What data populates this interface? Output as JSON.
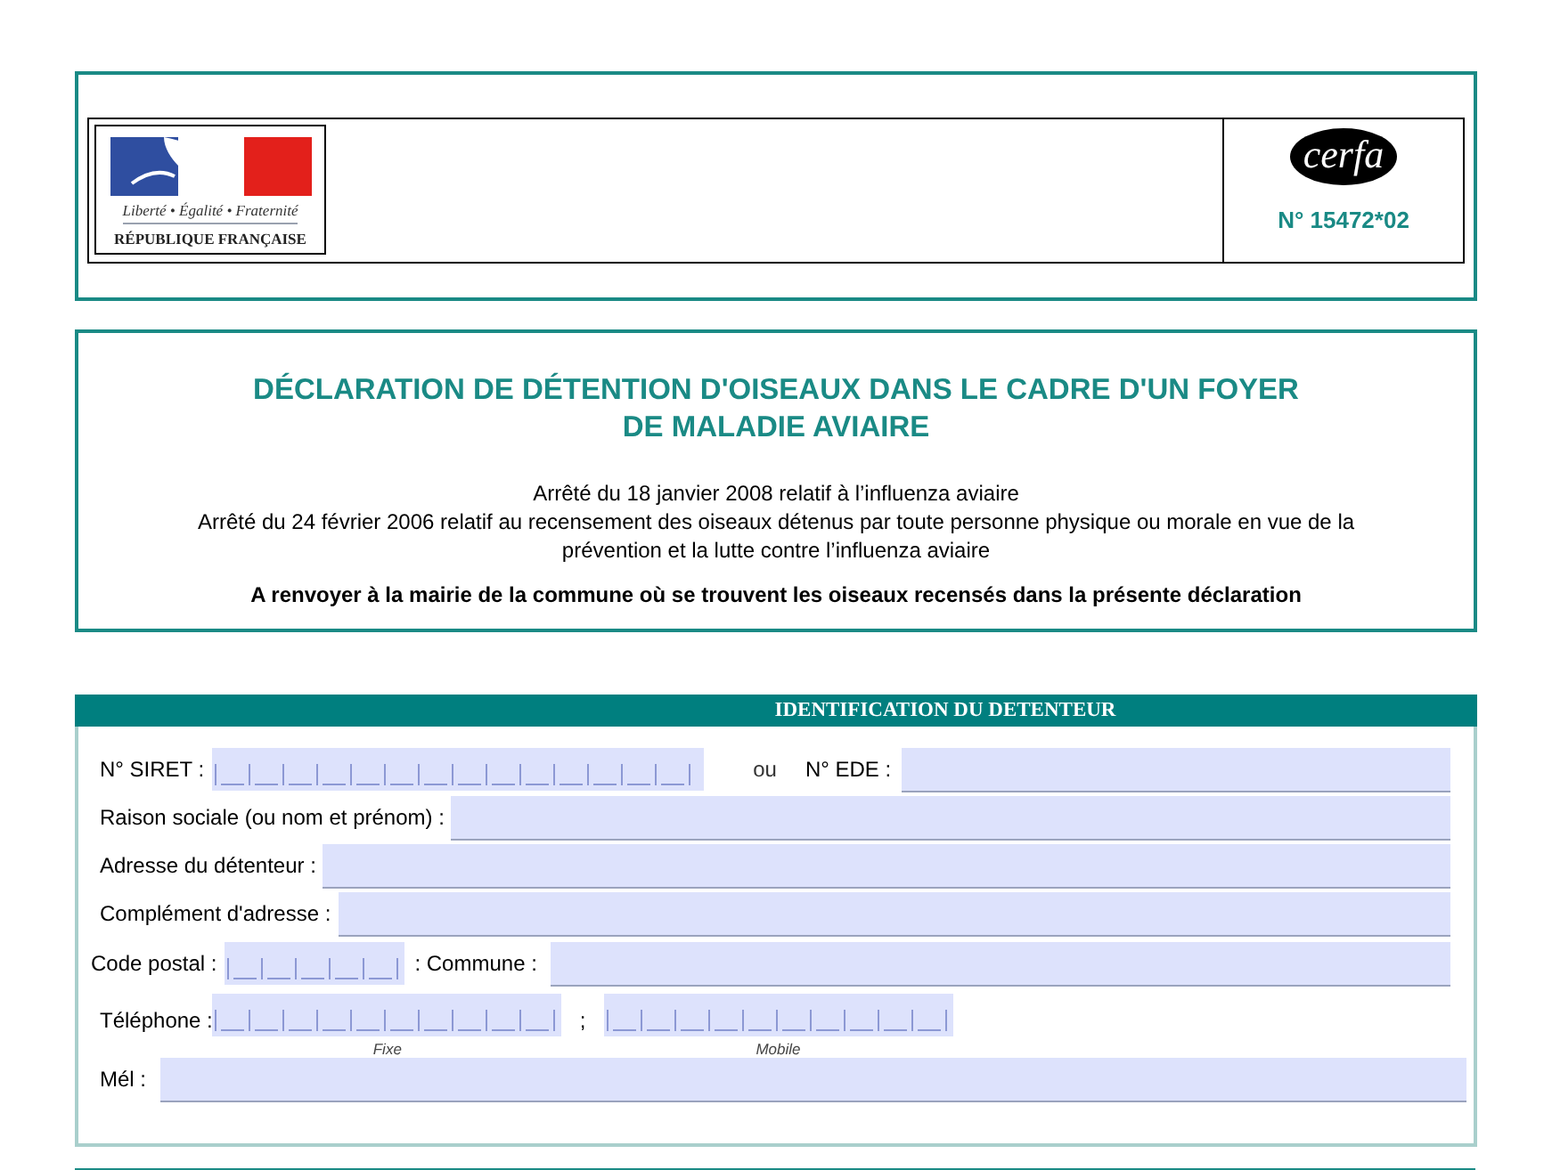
{
  "header": {
    "emblem_motto": "Liberté • Égalité • Fraternité",
    "emblem_name": "RÉPUBLIQUE FRANÇAISE",
    "cerfa_logo": "cerfa",
    "form_number": "N° 15472*02"
  },
  "title": {
    "heading_lines": [
      "DÉCLARATION DE DÉTENTION D'OISEAUX DANS LE CADRE D'UN FOYER",
      "DE MALADIE AVIAIRE"
    ],
    "references": [
      "Arrêté du 18  janvier 2008 relatif à l’influenza aviaire",
      "Arrêté du 24 février 2006 relatif au recensement des oiseaux détenus par toute personne physique ou morale en vue de la prévention et la lutte contre l’influenza aviaire"
    ],
    "instruction": "A renvoyer à la mairie de la commune où se trouvent les oiseaux recensés dans la présente déclaration"
  },
  "identification": {
    "header": "IDENTIFICATION DU DETENTEUR",
    "siret_label": "N° SIRET :",
    "or_text": "ou",
    "ede_label": "N° EDE :",
    "text_fields": [
      {
        "label": "Raison sociale (ou nom et prénom) :"
      },
      {
        "label": "Adresse du détenteur :"
      },
      {
        "label": "Complément d'adresse :"
      }
    ],
    "postal_label": "Code postal :",
    "commune_label": ": Commune :",
    "phone_label": "Téléphone  :",
    "phone_separator": ";",
    "fixe_caption": "Fixe",
    "mobile_caption": "Mobile",
    "mail_label": "Mél :"
  }
}
